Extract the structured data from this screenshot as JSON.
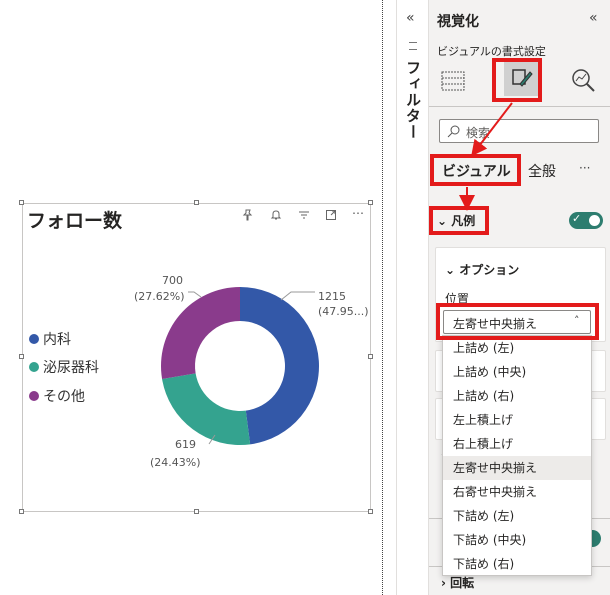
{
  "chart_data": {
    "type": "pie",
    "title": "フォロー数",
    "categories": [
      "内科",
      "泌尿器科",
      "その他"
    ],
    "values": [
      1215,
      619,
      700
    ],
    "percents": [
      "(47.95...)",
      "(24.43%)",
      "(27.62%)"
    ],
    "value_labels": [
      "1215",
      "619",
      "700"
    ],
    "colors": [
      "#3358a8",
      "#34a38f",
      "#8a3b8c"
    ],
    "donut": true,
    "legend_position": "left"
  },
  "visual": {
    "header_icons": [
      "pin-icon",
      "bell-icon",
      "filter-icon",
      "focus-icon",
      "more-icon"
    ],
    "more_glyph": "⋯"
  },
  "filter_pane": {
    "collapse_glyph": "«",
    "label": "フィルター"
  },
  "viz_pane": {
    "collapse_glyph": "«",
    "title": "視覚化",
    "subtitle": "ビジュアルの書式設定",
    "search_placeholder": "検索",
    "tabs": [
      "ビジュアル",
      "全般"
    ],
    "more_glyph": "···",
    "section_legend": "凡例",
    "options_title": "オプション",
    "position_label": "位置",
    "position_value": "左寄せ中央揃え",
    "dropdown_options": [
      "上詰め (左)",
      "上詰め (中央)",
      "上詰め (右)",
      "左上積上げ",
      "右上積上げ",
      "左寄せ中央揃え",
      "右寄せ中央揃え",
      "下詰め (左)",
      "下詰め (中央)",
      "下詰め (右)"
    ],
    "selected_index": 5,
    "rotate_label": "回転",
    "toggle_on": true
  },
  "colors": {
    "accent_red": "#e31b1b",
    "toggle_green": "#2d7d6f"
  }
}
